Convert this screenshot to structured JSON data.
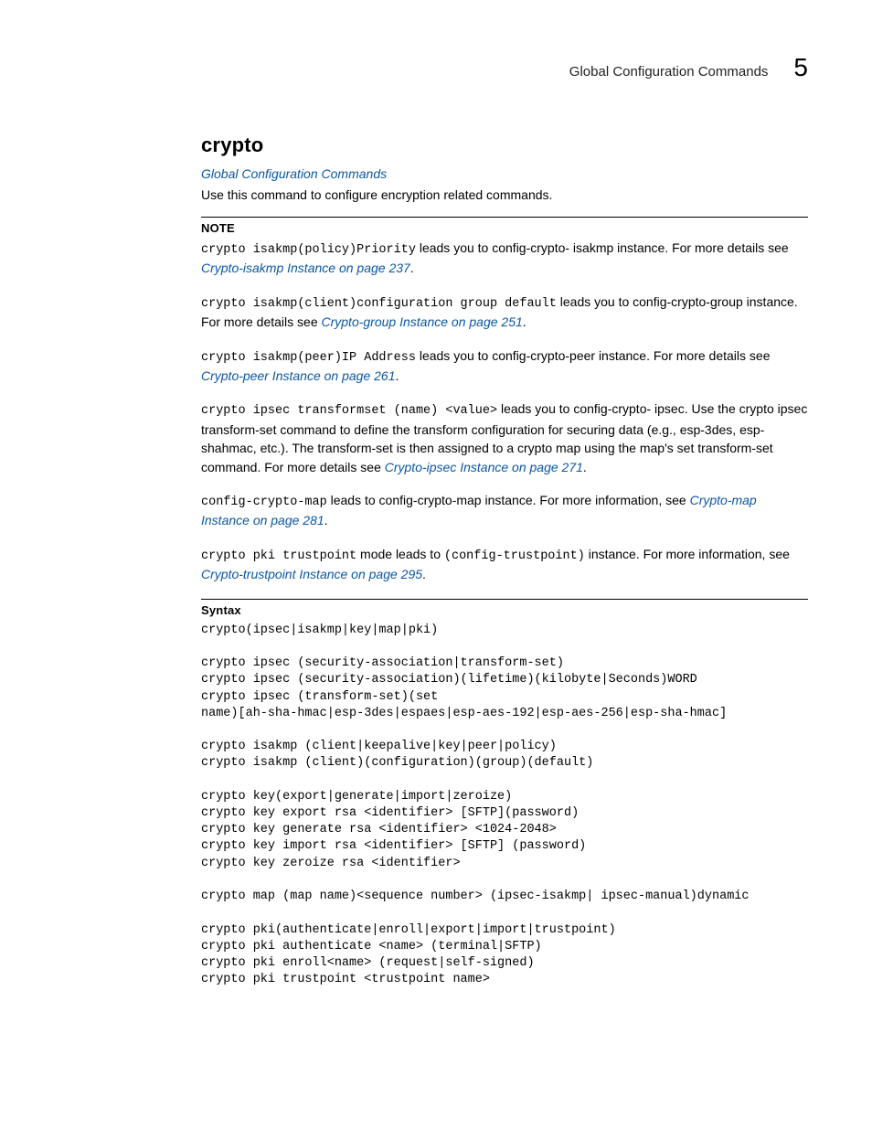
{
  "header": {
    "title": "Global Configuration Commands",
    "chapter_number": "5"
  },
  "section": {
    "heading": "crypto",
    "category_link": "Global Configuration Commands",
    "intro": "Use this command to configure encryption related commands."
  },
  "note": {
    "label": "NOTE",
    "p1_code": "crypto isakmp(policy)Priority",
    "p1_text": " leads you to config-crypto- isakmp instance. For more details see ",
    "p1_link": "Crypto-isakmp Instance on page 237",
    "p2_code": "crypto isakmp(client)configuration group default",
    "p2_text_a": " leads you to config-crypto-group instance. For more details see ",
    "p2_link": "Crypto-group Instance on page 251",
    "p3_code": "crypto isakmp(peer)IP Address",
    "p3_text": " leads you to config-crypto-peer instance. For more details see ",
    "p3_link": "Crypto-peer Instance on page 261",
    "p4_code": "crypto ipsec transformset (name) <value>",
    "p4_text": " leads you to config-crypto- ipsec. Use the crypto ipsec transform-set command to define the transform configuration for securing data (e.g., esp-3des, esp-shahmac, etc.). The transform-set is then assigned to a crypto map using the map's set transform-set command. For more details see ",
    "p4_link": "Crypto-ipsec Instance on page 271",
    "p5_code": "config-crypto-map",
    "p5_text": " leads to config-crypto-map instance. For more information, see ",
    "p5_link": "Crypto-map Instance on page 281",
    "p6_code_a": "crypto pki trustpoint",
    "p6_text_a": " mode leads to ",
    "p6_code_b": "(config-trustpoint)",
    "p6_text_b": " instance. For more information, see ",
    "p6_link": "Crypto-trustpoint Instance on page 295"
  },
  "syntax": {
    "label": "Syntax",
    "block": "crypto(ipsec|isakmp|key|map|pki)\n\ncrypto ipsec (security-association|transform-set)\ncrypto ipsec (security-association)(lifetime)(kilobyte|Seconds)WORD\ncrypto ipsec (transform-set)(set\nname)[ah-sha-hmac|esp-3des|espaes|esp-aes-192|esp-aes-256|esp-sha-hmac]\n\ncrypto isakmp (client|keepalive|key|peer|policy)\ncrypto isakmp (client)(configuration)(group)(default)\n\ncrypto key(export|generate|import|zeroize)\ncrypto key export rsa <identifier> [SFTP](password)\ncrypto key generate rsa <identifier> <1024-2048>\ncrypto key import rsa <identifier> [SFTP] (password)\ncrypto key zeroize rsa <identifier>\n\ncrypto map (map name)<sequence number> (ipsec-isakmp| ipsec-manual)dynamic\n\ncrypto pki(authenticate|enroll|export|import|trustpoint)\ncrypto pki authenticate <name> (terminal|SFTP)\ncrypto pki enroll<name> (request|self-signed)\ncrypto pki trustpoint <trustpoint name>"
  }
}
